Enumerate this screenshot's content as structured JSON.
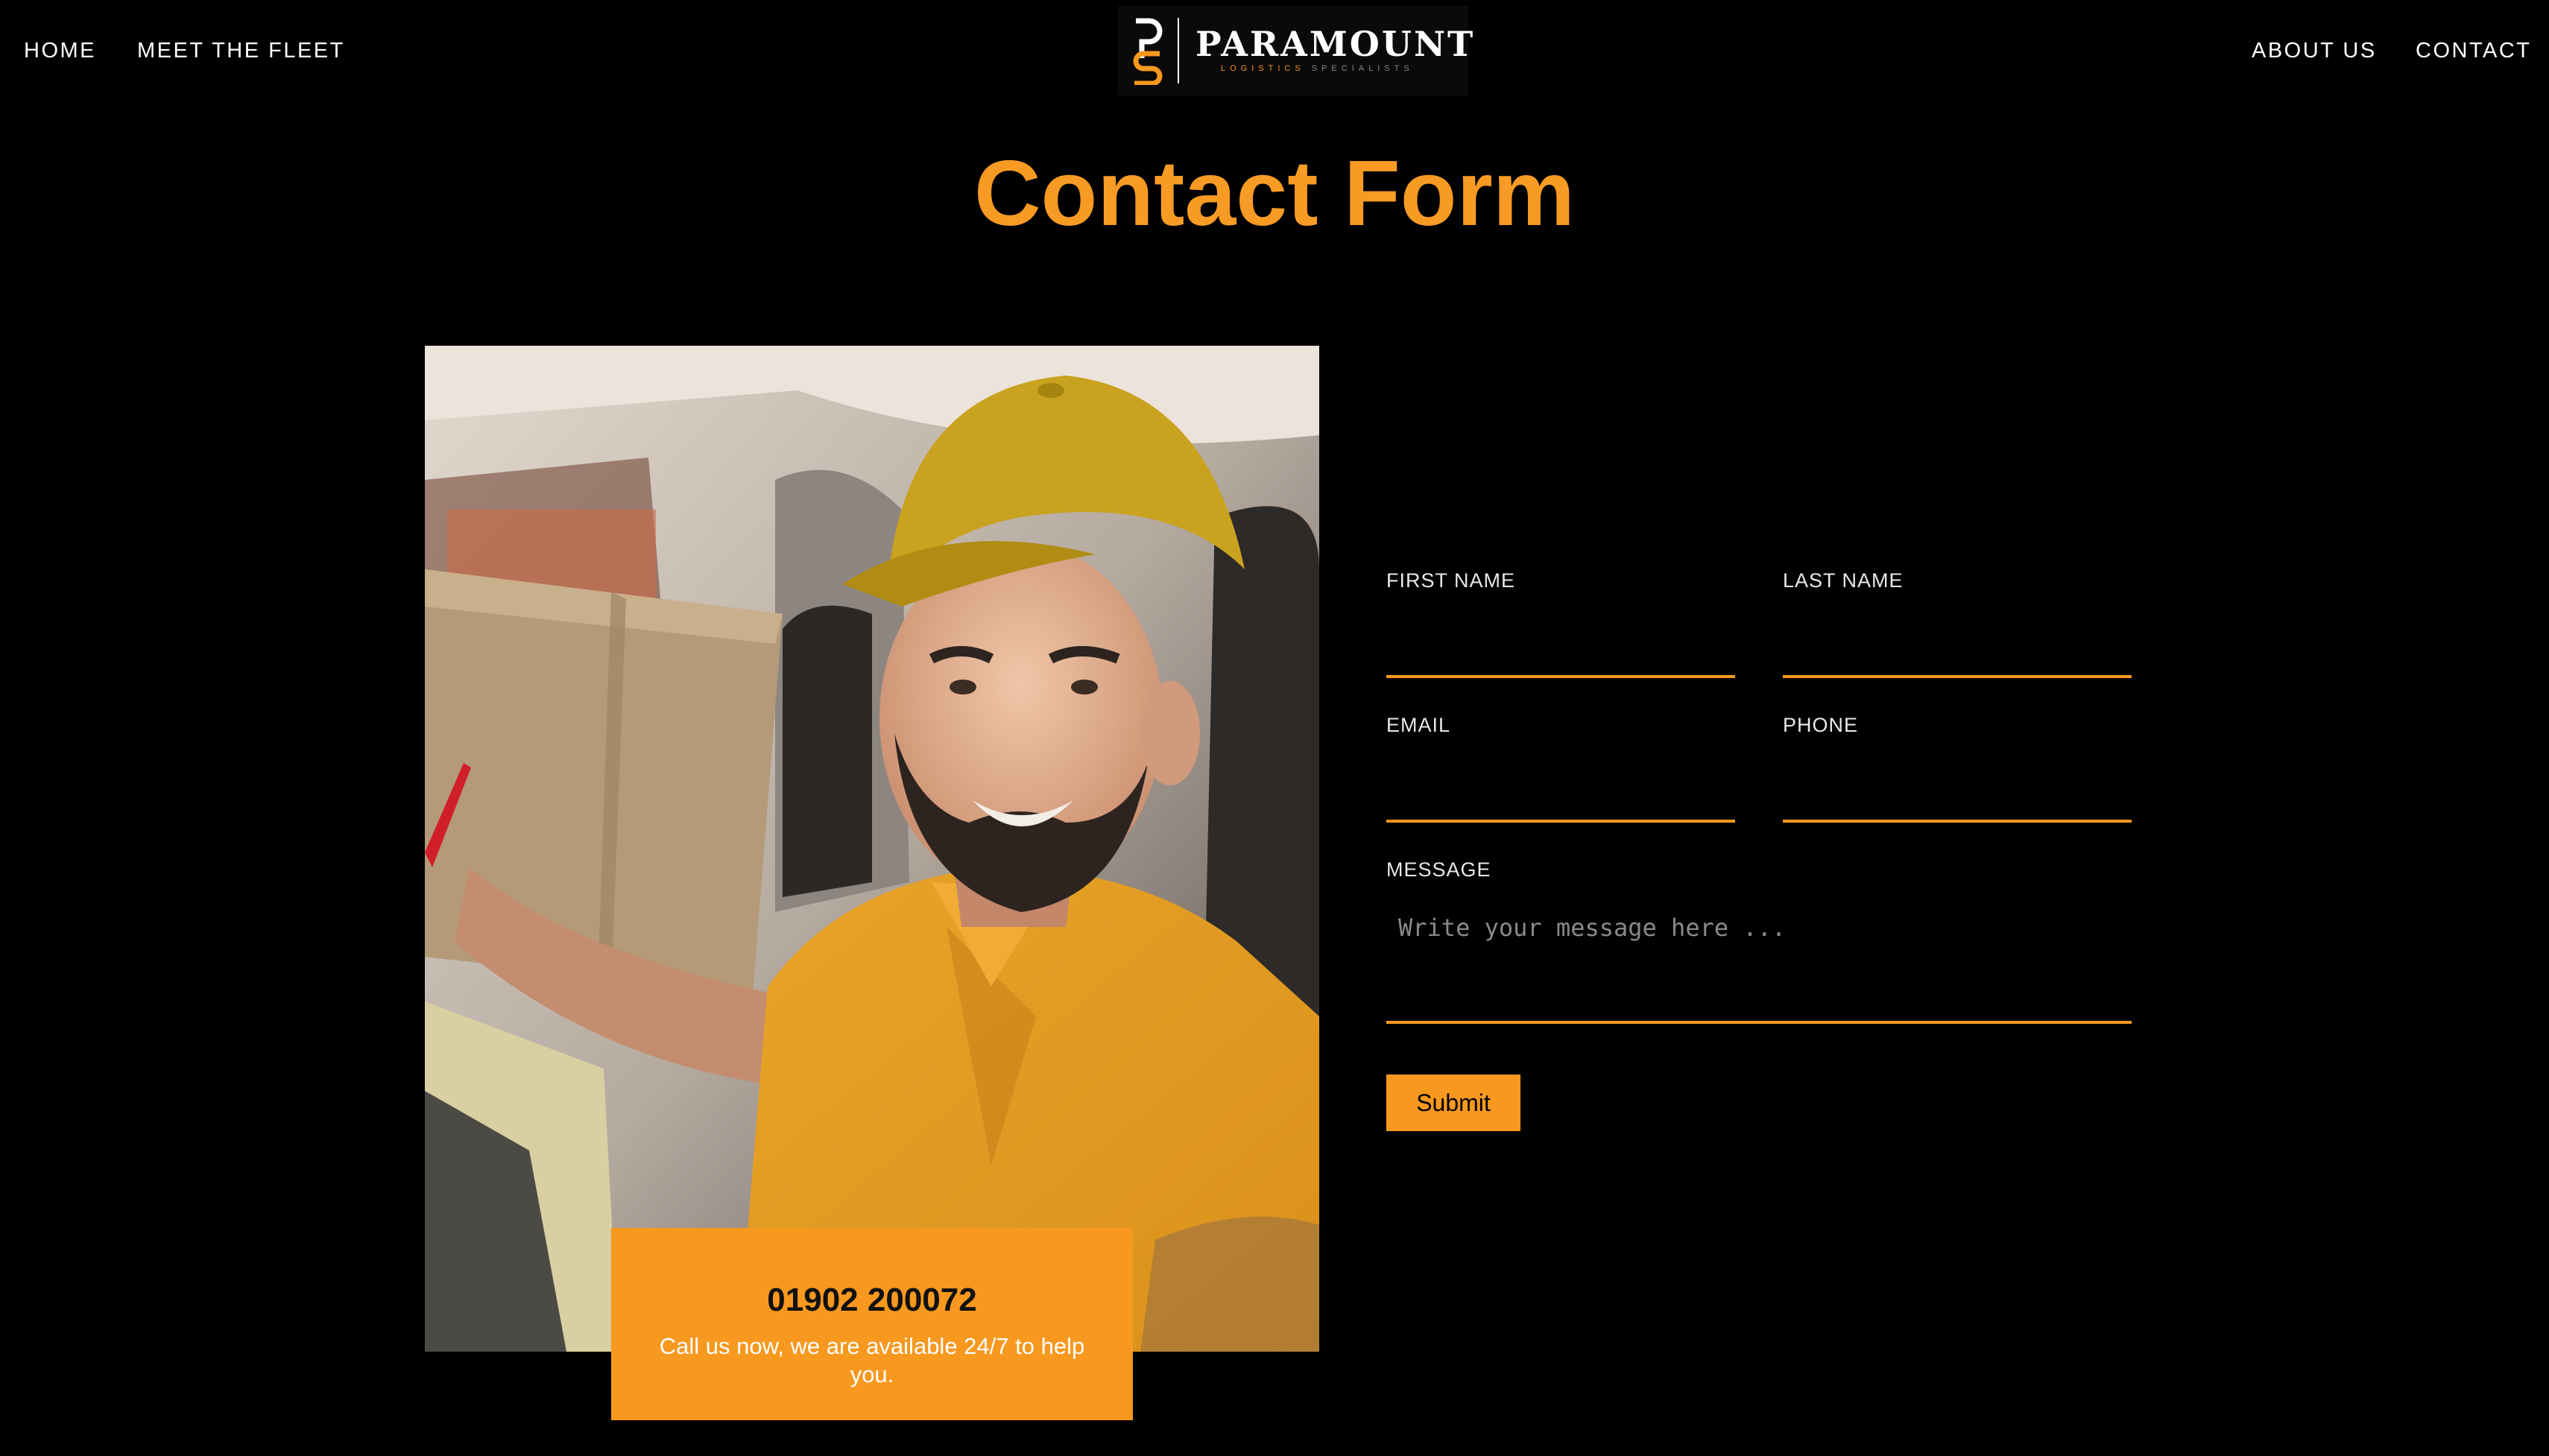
{
  "nav": {
    "home": "HOME",
    "fleet": "MEET THE FLEET",
    "about": "ABOUT US",
    "contact": "CONTACT"
  },
  "logo": {
    "name": "PARAMOUNT",
    "tagline_a": "LOGISTICS",
    "tagline_b": "SPECIALISTS"
  },
  "page": {
    "title": "Contact Form"
  },
  "call": {
    "phone": "01902 200072",
    "text": "Call us now, we are available 24/7 to help you."
  },
  "form": {
    "first_name_label": "FIRST NAME",
    "first_name_value": "",
    "last_name_label": "LAST NAME",
    "last_name_value": "",
    "email_label": "EMAIL",
    "email_value": "",
    "phone_label": "PHONE",
    "phone_value": "",
    "message_label": "MESSAGE",
    "message_placeholder": "Write your message here ...",
    "submit_label": "Submit"
  },
  "colors": {
    "accent": "#f7981f",
    "title": "#f89b24",
    "background": "#000000"
  }
}
